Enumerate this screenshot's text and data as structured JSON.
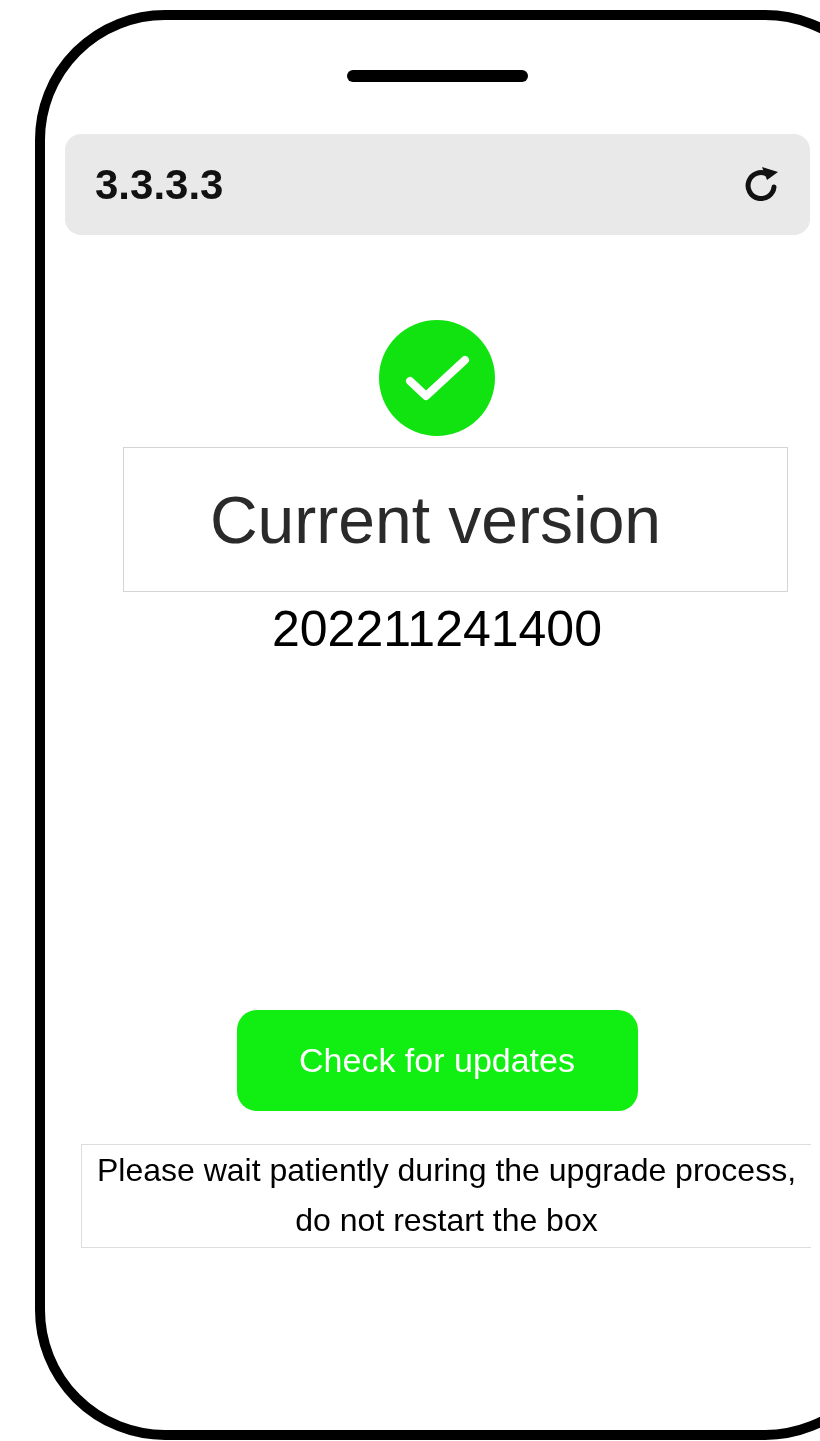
{
  "address_bar": {
    "value": "3.3.3.3"
  },
  "status": {
    "title": "Current version",
    "version": "202211241400"
  },
  "check_button": {
    "label": "Check for updates"
  },
  "notice": "Please wait patiently during the upgrade process, do not restart the box"
}
